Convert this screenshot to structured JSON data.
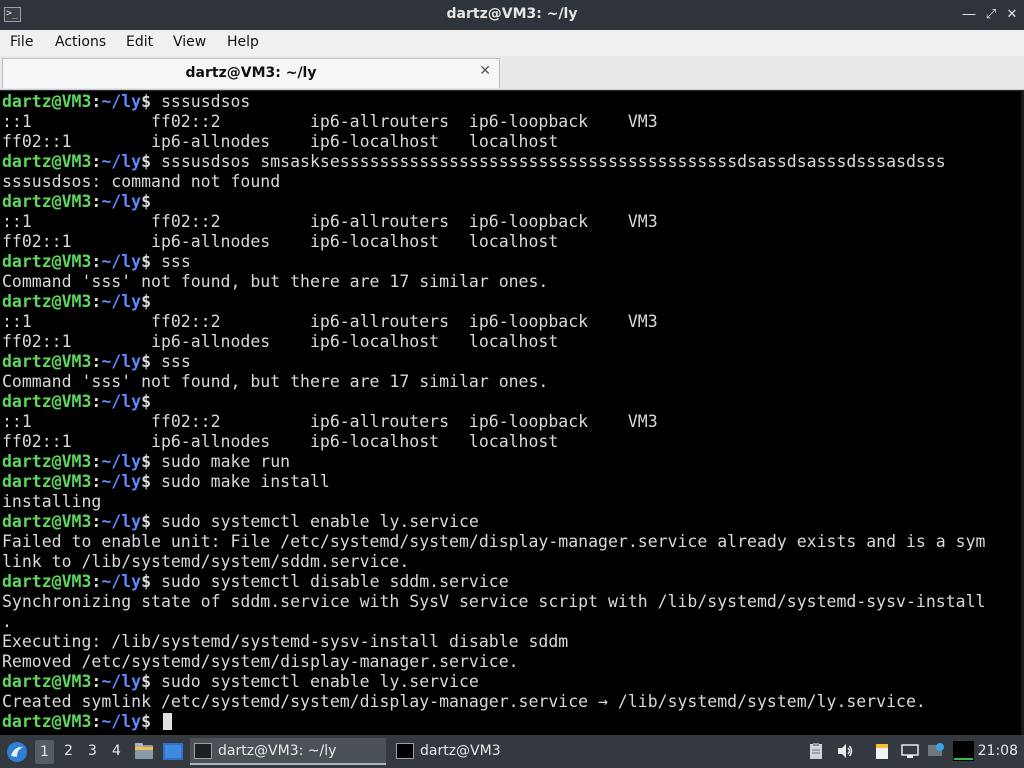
{
  "window": {
    "title": "dartz@VM3: ~/ly",
    "app_icon_glyph": ">_",
    "buttons": {
      "minimize": "―",
      "maximize": "⤢",
      "close": "✕"
    }
  },
  "menubar": {
    "items": [
      {
        "label": "File"
      },
      {
        "label": "Actions"
      },
      {
        "label": "Edit"
      },
      {
        "label": "View"
      },
      {
        "label": "Help"
      }
    ]
  },
  "tabs": [
    {
      "label": "dartz@VM3: ~/ly",
      "close": "✕"
    }
  ],
  "prompt": {
    "user_host": "dartz@VM3",
    "sep": ":",
    "path": "~/ly",
    "symbol": "$"
  },
  "terminal": {
    "lines": [
      {
        "prompt": true,
        "text": " sssusdsos"
      },
      {
        "prompt": false,
        "text": "::1            ff02::2         ip6-allrouters  ip6-loopback    VM3"
      },
      {
        "prompt": false,
        "text": "ff02::1        ip6-allnodes    ip6-localhost   localhost"
      },
      {
        "prompt": true,
        "text": " sssusdsos smsasksessssssssssssssssssssssssssssssssssssssssdsassdsasssdsssasdsss"
      },
      {
        "prompt": false,
        "text": "sssusdsos: command not found"
      },
      {
        "prompt": true,
        "text": ""
      },
      {
        "prompt": false,
        "text": "::1            ff02::2         ip6-allrouters  ip6-loopback    VM3"
      },
      {
        "prompt": false,
        "text": "ff02::1        ip6-allnodes    ip6-localhost   localhost"
      },
      {
        "prompt": true,
        "text": " sss"
      },
      {
        "prompt": false,
        "text": "Command 'sss' not found, but there are 17 similar ones."
      },
      {
        "prompt": true,
        "text": ""
      },
      {
        "prompt": false,
        "text": "::1            ff02::2         ip6-allrouters  ip6-loopback    VM3"
      },
      {
        "prompt": false,
        "text": "ff02::1        ip6-allnodes    ip6-localhost   localhost"
      },
      {
        "prompt": true,
        "text": " sss"
      },
      {
        "prompt": false,
        "text": "Command 'sss' not found, but there are 17 similar ones."
      },
      {
        "prompt": true,
        "text": ""
      },
      {
        "prompt": false,
        "text": "::1            ff02::2         ip6-allrouters  ip6-loopback    VM3"
      },
      {
        "prompt": false,
        "text": "ff02::1        ip6-allnodes    ip6-localhost   localhost"
      },
      {
        "prompt": true,
        "text": " sudo make run"
      },
      {
        "prompt": true,
        "text": " sudo make install"
      },
      {
        "prompt": false,
        "text": "installing"
      },
      {
        "prompt": true,
        "text": " sudo systemctl enable ly.service"
      },
      {
        "prompt": false,
        "text": "Failed to enable unit: File /etc/systemd/system/display-manager.service already exists and is a sym"
      },
      {
        "prompt": false,
        "text": "link to /lib/systemd/system/sddm.service."
      },
      {
        "prompt": true,
        "text": " sudo systemctl disable sddm.service"
      },
      {
        "prompt": false,
        "text": "Synchronizing state of sddm.service with SysV service script with /lib/systemd/systemd-sysv-install"
      },
      {
        "prompt": false,
        "text": "."
      },
      {
        "prompt": false,
        "text": "Executing: /lib/systemd/systemd-sysv-install disable sddm"
      },
      {
        "prompt": false,
        "text": "Removed /etc/systemd/system/display-manager.service."
      },
      {
        "prompt": true,
        "text": " sudo systemctl enable ly.service"
      },
      {
        "prompt": false,
        "text": "Created symlink /etc/systemd/system/display-manager.service → /lib/systemd/system/ly.service."
      },
      {
        "prompt": true,
        "text": " ",
        "cursor": true
      }
    ]
  },
  "taskbar": {
    "workspaces": [
      "1",
      "2",
      "3",
      "4"
    ],
    "tasks": [
      {
        "label": "dartz@VM3: ~/ly"
      },
      {
        "label": "dartz@VM3"
      }
    ],
    "clock": "21:08"
  },
  "colors": {
    "prompt_user": "#5fd75f",
    "prompt_path": "#5f87ff",
    "terminal_bg": "#000000",
    "terminal_fg": "#d9d9d9"
  }
}
